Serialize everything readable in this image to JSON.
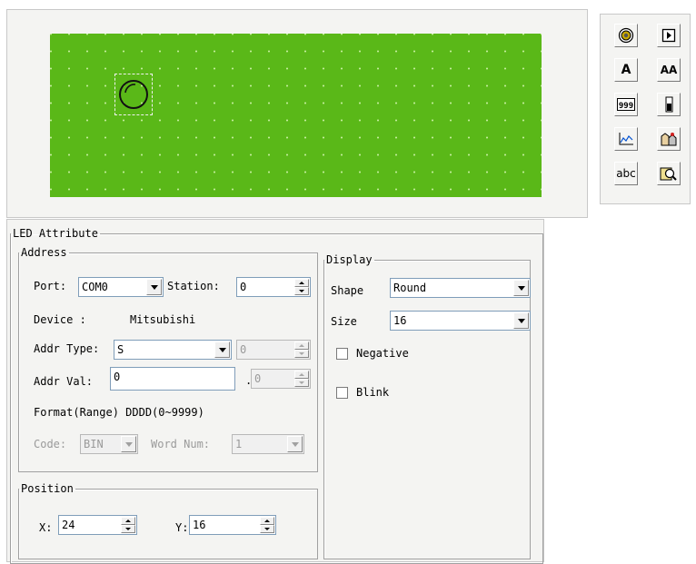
{
  "toolbox": {
    "tools": [
      {
        "name": "led-tool-icon",
        "glyph": "◎"
      },
      {
        "name": "button-tool-icon",
        "glyph": "▶"
      },
      {
        "name": "text-tool-icon",
        "glyph": "A"
      },
      {
        "name": "large-text-tool-icon",
        "glyph": "AA"
      },
      {
        "name": "numeric-display-tool-icon",
        "glyph": "999"
      },
      {
        "name": "bargraph-tool-icon",
        "glyph": "▮"
      },
      {
        "name": "trend-graph-tool-icon",
        "glyph": "〰"
      },
      {
        "name": "picture-tool-icon",
        "glyph": "▣"
      },
      {
        "name": "ascii-text-tool-icon",
        "glyph": "abc"
      },
      {
        "name": "alarm-search-tool-icon",
        "glyph": "🔍"
      }
    ]
  },
  "attribute_panel": {
    "title": "LED Attribute",
    "address": {
      "legend": "Address",
      "port_label": "Port:",
      "port_value": "COM0",
      "station_label": "Station:",
      "station_value": "0",
      "device_label": "Device :",
      "device_value": "Mitsubishi",
      "addr_type_label": "Addr Type:",
      "addr_type_value": "S",
      "addr_type_sub_value": "0",
      "addr_val_label": "Addr Val:",
      "addr_val_value": "0",
      "addr_val_dot": ".",
      "addr_val_sub_value": "0",
      "format_label": "Format(Range) DDDD(0~9999)",
      "code_label": "Code:",
      "code_value": "BIN",
      "word_num_label": "Word Num:",
      "word_num_value": "1"
    },
    "position": {
      "legend": "Position",
      "x_label": "X:",
      "x_value": "24",
      "y_label": "Y:",
      "y_value": "16"
    },
    "display": {
      "legend": "Display",
      "shape_label": "Shape",
      "shape_value": "Round",
      "size_label": "Size",
      "size_value": "16",
      "negative_label": "Negative",
      "negative_checked": false,
      "blink_label": "Blink",
      "blink_checked": false
    }
  },
  "colors": {
    "lcd_background": "#5ab818",
    "led_ring": "#111111",
    "panel_background": "#f4f4f2"
  }
}
